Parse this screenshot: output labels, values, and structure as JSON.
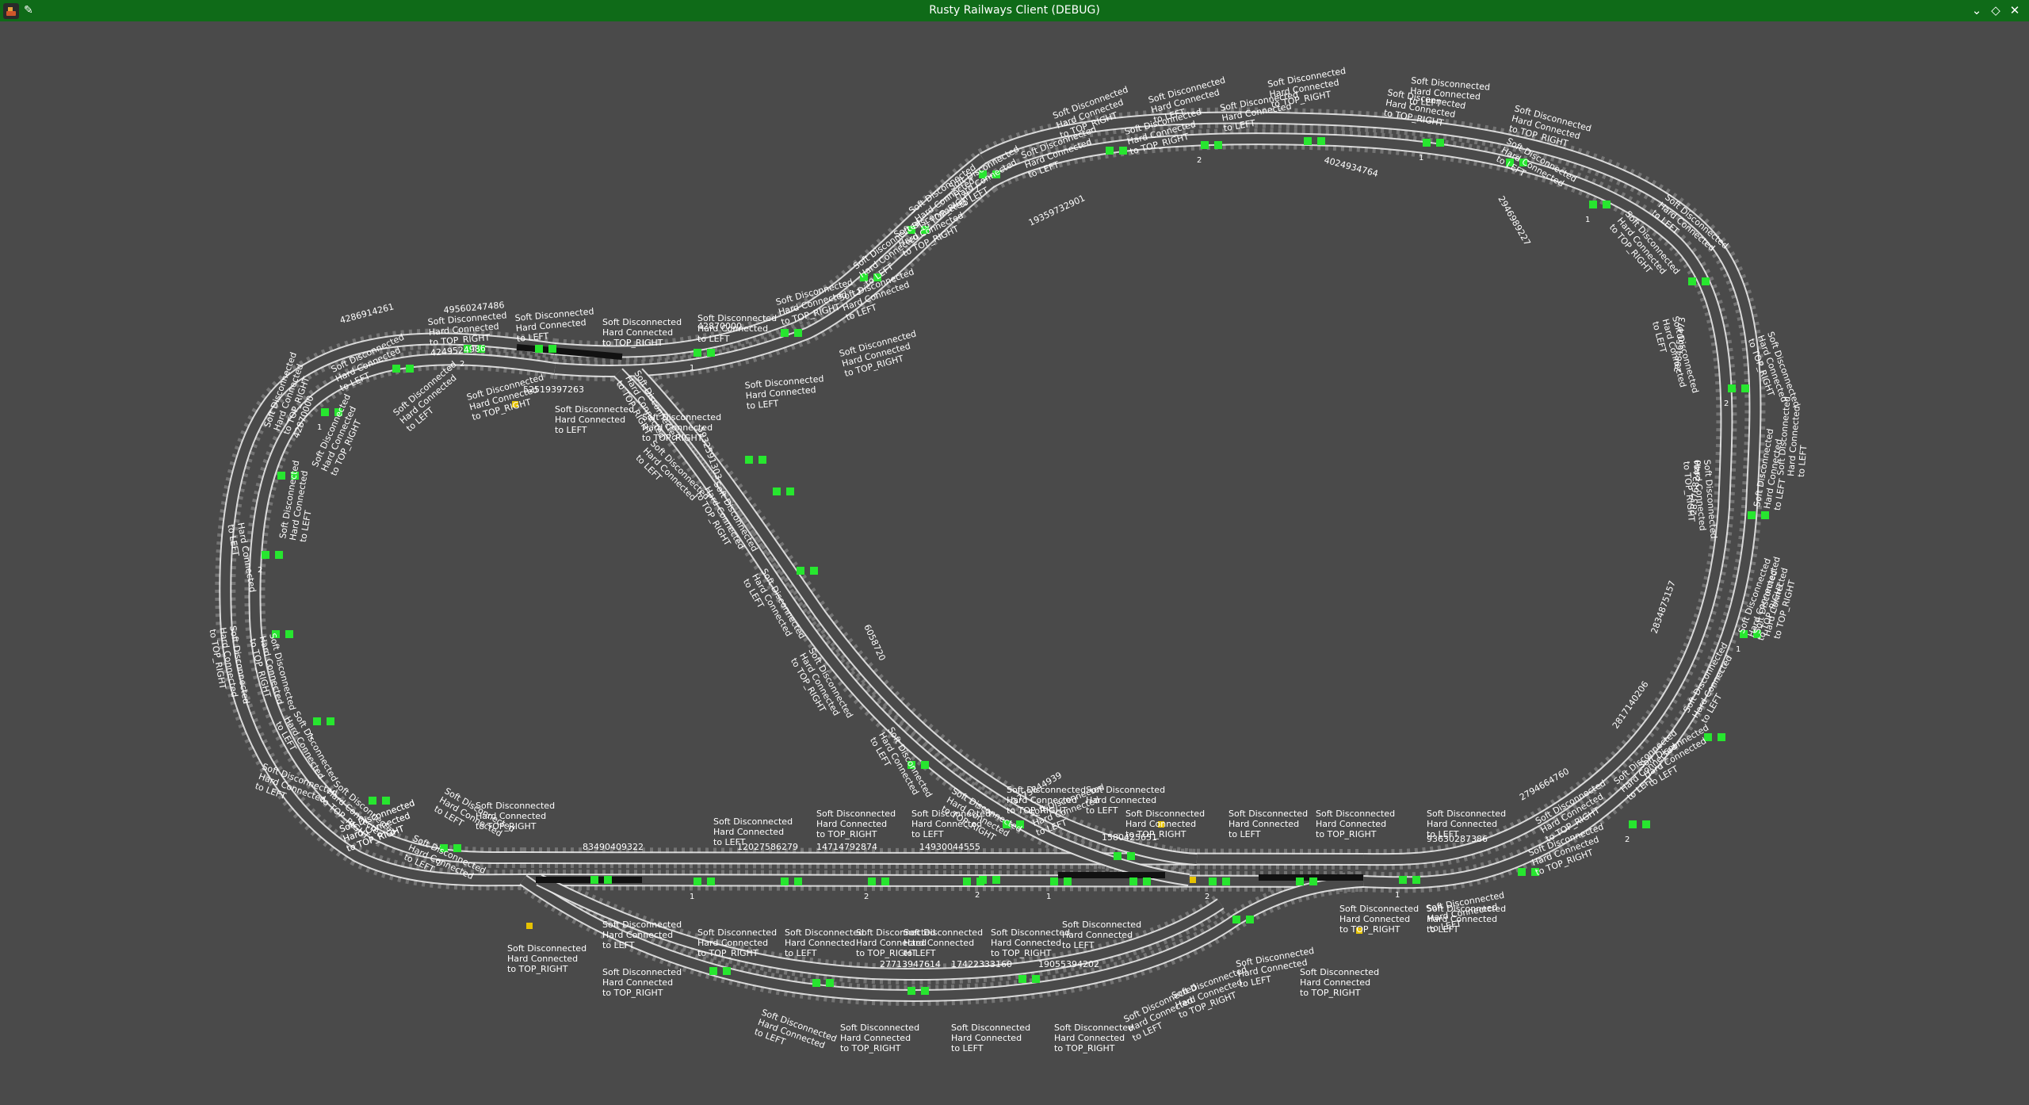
{
  "window": {
    "title": "Rusty Railways Client (DEBUG)",
    "icons": {
      "app": "app-icon",
      "pin": "pin-icon",
      "minimize": "chevron-down-icon",
      "maximize": "diamond-icon",
      "close": "close-icon"
    }
  },
  "colors": {
    "titlebar": "#0f6b18",
    "background": "#4a4a4a",
    "rail": "#e8e8e8",
    "tie": "#7a7a7a",
    "signal": "#27e62f",
    "train": "#111111",
    "switch_light": "#e6c200"
  },
  "labels": [
    {
      "id": "l1",
      "lines": [
        "Soft Disconnected",
        "Hard Connected",
        "to TOP_RIGHT"
      ]
    },
    {
      "id": "l2",
      "lines": [
        "Soft Disconnected",
        "Hard Connected",
        "to LEFT"
      ]
    },
    {
      "id": "l3",
      "lines": [
        "Soft Disconnected",
        "Hard Connected",
        "to TOP_RIGHT"
      ]
    },
    {
      "id": "l4",
      "lines": [
        "Hard Connected",
        "to LEFT"
      ]
    },
    {
      "id": "l5",
      "lines": [
        "Soft Disconnected",
        "Hard Connected",
        "to TOP_RIGHT",
        "42870000"
      ]
    },
    {
      "id": "l6",
      "lines": [
        "Soft Disconnected",
        "Hard Connected",
        "to LEFT"
      ]
    },
    {
      "id": "l7",
      "lines": [
        "Soft Disconnected",
        "Hard Connected",
        "to TOP_RIGHT",
        "4249524986"
      ]
    },
    {
      "id": "l8",
      "lines": [
        "Soft Disconnected",
        "Hard Connected",
        "to LEFT"
      ]
    },
    {
      "id": "l9",
      "lines": [
        "Soft Disconnected",
        "Hard Connected",
        "to TOP_RIGHT"
      ]
    },
    {
      "id": "l10",
      "lines": [
        "Soft Disconnected",
        "Hard Connected",
        "to LEFT"
      ]
    },
    {
      "id": "l11",
      "lines": [
        "Soft Disconnected",
        "Hard Connected",
        "to TOP_RIGHT"
      ]
    },
    {
      "id": "l12",
      "lines": [
        "Soft Disconnected",
        "Hard Connected",
        "to LEFT"
      ]
    },
    {
      "id": "l13",
      "lines": [
        "Soft Disconnected",
        "Hard Connected",
        "to TOP_RIGHT"
      ]
    },
    {
      "id": "l14",
      "lines": [
        "Soft Disconnected",
        "Hard Connected",
        "to LEFT"
      ]
    },
    {
      "id": "l15",
      "lines": [
        "Soft Disconnected",
        "Hard Connected",
        "to TOP_RIGHT"
      ]
    },
    {
      "id": "l16",
      "lines": [
        "Soft Disconnected",
        "Hard Connected",
        "to LEFT"
      ]
    },
    {
      "id": "l17",
      "lines": [
        "Soft Disconnected",
        "Hard Connected",
        "to TOP_RIGHT"
      ]
    },
    {
      "id": "l18",
      "lines": [
        "Soft Disconnected",
        "Hard Connected",
        "to LEFT"
      ]
    },
    {
      "id": "l19",
      "lines": [
        "Soft Disconnected",
        "Hard Connected",
        "to TOP_RIGHT"
      ]
    },
    {
      "id": "l20",
      "lines": [
        "Soft Disconnected",
        "Hard Connected",
        "to LEFT"
      ]
    },
    {
      "id": "l21",
      "lines": [
        "Soft Disconnected",
        "Hard Connected",
        "to TOP_RIGHT"
      ]
    },
    {
      "id": "l22",
      "lines": [
        "Soft Disconnected",
        "Hard Connected",
        "to LEFT"
      ]
    },
    {
      "id": "l23",
      "lines": [
        "Soft Disconnected",
        "Hard Connected",
        "to TOP_RIGHT"
      ]
    },
    {
      "id": "l24",
      "lines": [
        "Soft Disconnected",
        "Hard Connected",
        "to LEFT"
      ]
    },
    {
      "id": "l25",
      "lines": [
        "Soft Disconnected",
        "Hard Connected",
        "to LEFT"
      ]
    },
    {
      "id": "l26",
      "lines": [
        "Soft Disconnected",
        "Hard Connected",
        "to TOP_RIGHT"
      ]
    },
    {
      "id": "l27",
      "lines": [
        "Soft Disconnected",
        "Hard Connected",
        "to LEFT"
      ]
    },
    {
      "id": "l28",
      "lines": [
        "Soft Disconnected",
        "Hard Connected",
        "to TOP_RIGHT"
      ]
    },
    {
      "id": "l29",
      "lines": [
        "Soft Disconnected",
        "Hard Connected",
        "to LEFT"
      ]
    },
    {
      "id": "l30",
      "lines": [
        "Soft Disconnected",
        "Hard Connected",
        "to TOP_RIGHT"
      ]
    },
    {
      "id": "l31",
      "lines": [
        "Soft Disconnected",
        "Hard Connected",
        "to LEFT"
      ]
    },
    {
      "id": "l32",
      "lines": [
        "Soft Disconnected",
        "Hard Connected",
        "to TOP_RIGHT"
      ]
    },
    {
      "id": "l33",
      "lines": [
        "Soft Disconnected",
        "Hard Connected",
        "to LEFT"
      ]
    },
    {
      "id": "l34",
      "lines": [
        "Soft Disconnected",
        "Hard Connected",
        "to TOP_RIGHT"
      ]
    },
    {
      "id": "l35",
      "lines": [
        "Soft Disconnected",
        "Hard Connected",
        "to LEFT"
      ]
    },
    {
      "id": "l36",
      "lines": [
        "Soft Disconnected",
        "Hard Connected",
        "to TOP_RIGHT"
      ]
    },
    {
      "id": "l37",
      "lines": [
        "Soft Disconnected",
        "Hard Connected",
        "to LEFT"
      ]
    },
    {
      "id": "l38",
      "lines": [
        "Soft Disconnected",
        "Hard Connected",
        "to TOP_RIGHT"
      ]
    },
    {
      "id": "l39",
      "lines": [
        "Soft Disconnected",
        "Hard Connected",
        "to LEFT"
      ]
    },
    {
      "id": "l40",
      "lines": [
        "Soft Disconnected",
        "Hard Connected",
        "to TOP_RIGHT"
      ]
    },
    {
      "id": "l41",
      "lines": [
        "Soft Disconnected",
        "Hard Connected",
        "to LEFT"
      ]
    },
    {
      "id": "l42",
      "lines": [
        "Soft Disconnected",
        "Hard Connected",
        "to TOP_RIGHT"
      ]
    },
    {
      "id": "l43",
      "lines": [
        "Soft Disconnected",
        "Hard Connected",
        "to LEFT"
      ]
    },
    {
      "id": "l44",
      "lines": [
        "Soft Disconnected",
        "Hard Connected",
        "to TOP_RIGHT"
      ]
    },
    {
      "id": "l45",
      "lines": [
        "Soft Disconnected",
        "Hard Connected",
        "to LEFT"
      ]
    },
    {
      "id": "l46",
      "lines": [
        "Soft Disconnected",
        "Hard Connected",
        "to TOP_RIGHT"
      ]
    },
    {
      "id": "l47",
      "lines": [
        "Soft Disconnected",
        "Hard Connected",
        "to LEFT"
      ]
    },
    {
      "id": "l48",
      "lines": [
        "Soft Disconnected",
        "Hard Connected",
        "to TOP_RIGHT"
      ]
    },
    {
      "id": "l49",
      "lines": [
        "Soft Disconnected",
        "Hard Connected",
        "to LEFT"
      ]
    },
    {
      "id": "l50",
      "lines": [
        "Soft Disconnected",
        "Hard Connected",
        "to TOP_RIGHT"
      ]
    },
    {
      "id": "l51",
      "lines": [
        "Soft Disconnected",
        "Hard Connected",
        "to LEFT"
      ]
    },
    {
      "id": "l52",
      "lines": [
        "Soft Disconnected",
        "Hard Connected",
        "to TOP_RIGHT"
      ]
    },
    {
      "id": "l53",
      "lines": [
        "Soft Disconnected",
        "Hard Connected",
        "to LEFT"
      ]
    },
    {
      "id": "l54",
      "lines": [
        "Soft Disconnected",
        "Hard Connected",
        "to TOP_RIGHT"
      ]
    },
    {
      "id": "l55",
      "lines": [
        "Soft Disconnected",
        "Hard Connected",
        "to LEFT"
      ]
    },
    {
      "id": "l56",
      "lines": [
        "Soft Disconnected",
        "Hard Connected",
        "to TOP_RIGHT"
      ]
    },
    {
      "id": "l57",
      "lines": [
        "Soft Disconnected",
        "Hard Connected",
        "to LEFT"
      ]
    },
    {
      "id": "l58",
      "lines": [
        "Soft Disconnected",
        "Hard Connected",
        "to TOP_RIGHT"
      ]
    },
    {
      "id": "l59",
      "lines": [
        "Soft Disconnected",
        "Hard Connected",
        "to LEFT"
      ]
    },
    {
      "id": "l60",
      "lines": [
        "Soft Disconnected",
        "Hard Connected",
        "to TOP_RIGHT"
      ]
    },
    {
      "id": "l61",
      "lines": [
        "Soft Disconnected",
        "Hard Connected",
        "to LEFT"
      ]
    },
    {
      "id": "l62",
      "lines": [
        "Soft Disconnected",
        "Hard Connected",
        "to TOP_RIGHT"
      ]
    },
    {
      "id": "l63",
      "lines": [
        "Soft Disconnected",
        "Hard Connected",
        "to LEFT"
      ]
    },
    {
      "id": "l64",
      "lines": [
        "Soft Disconnected",
        "Hard Connected",
        "to TOP_RIGHT"
      ]
    },
    {
      "id": "l65",
      "lines": [
        "Soft Disconnected",
        "Hard Connected",
        "to LEFT"
      ]
    },
    {
      "id": "l66",
      "lines": [
        "Soft Disconnected",
        "Hard Connected",
        "to TOP_RIGHT"
      ]
    },
    {
      "id": "l67",
      "lines": [
        "Soft Disconnected",
        "Hard Connected",
        "to LEFT"
      ]
    },
    {
      "id": "l68",
      "lines": [
        "Soft Disconnected",
        "Hard Connected",
        "to TOP_RIGHT"
      ]
    },
    {
      "id": "l69",
      "lines": [
        "Soft Disconnected",
        "Hard Connected",
        "to LEFT"
      ]
    },
    {
      "id": "l70",
      "lines": [
        "Soft Disconnected",
        "Hard Connected",
        "to TOP_RIGHT"
      ]
    },
    {
      "id": "l71",
      "lines": [
        "Soft Disconnected",
        "Hard Connected",
        "to LEFT"
      ]
    },
    {
      "id": "l72",
      "lines": [
        "Soft Disconnected",
        "Hard Connected",
        "to TOP_RIGHT"
      ]
    },
    {
      "id": "l73",
      "lines": [
        "Soft Disconnected",
        "Hard Connected",
        "to LEFT"
      ]
    },
    {
      "id": "l74",
      "lines": [
        "Soft Disconnected",
        "Hard Connected",
        "to TOP_RIGHT"
      ]
    },
    {
      "id": "l75",
      "lines": [
        "Soft Disconnected",
        "Hard Connected",
        "to LEFT"
      ]
    },
    {
      "id": "l76",
      "lines": [
        "Soft Disconnected",
        "Hard Connected",
        "to TOP_RIGHT"
      ]
    },
    {
      "id": "l77",
      "lines": [
        "Soft Disconnected",
        "Hard Connected",
        "to LEFT"
      ]
    },
    {
      "id": "l78",
      "lines": [
        "Soft Disconnected",
        "Hard Connected",
        "to TOP_RIGHT"
      ]
    },
    {
      "id": "l79",
      "lines": [
        "Soft Disconnected",
        "Hard Connected",
        "to LEFT"
      ]
    },
    {
      "id": "l80",
      "lines": [
        "Soft Disconnected",
        "Hard Connected",
        "to TOP_RIGHT"
      ]
    },
    {
      "id": "l81",
      "lines": [
        "Soft Disconnected",
        "Hard Connected",
        "to LEFT"
      ]
    },
    {
      "id": "l82",
      "lines": [
        "Soft Disconnected",
        "Hard Connected",
        "to TOP_RIGHT"
      ]
    },
    {
      "id": "l83",
      "lines": [
        "Soft Disconnected",
        "Hard Connected",
        "to LEFT"
      ]
    },
    {
      "id": "l84",
      "lines": [
        "Soft Disconnected",
        "Hard Connected",
        "to TOP_RIGHT"
      ]
    },
    {
      "id": "l85",
      "lines": [
        "Soft Disconnected",
        "Hard Connected",
        "to LEFT"
      ]
    },
    {
      "id": "l86",
      "lines": [
        "Soft Disconnected",
        "Hard Connected",
        "to TOP_RIGHT"
      ]
    },
    {
      "id": "l87",
      "lines": [
        "Soft Disconnected",
        "Hard Connected",
        "to LEFT"
      ]
    },
    {
      "id": "l88",
      "lines": [
        "Soft Disconnected",
        "Hard Connected",
        "to TOP_RIGHT"
      ]
    },
    {
      "id": "l89",
      "lines": [
        "Soft Disconnected",
        "Hard Connected",
        "to LEFT"
      ]
    },
    {
      "id": "l90",
      "lines": [
        "Soft Disconnected",
        "Hard Connected",
        "to TOP_RIGHT"
      ]
    },
    {
      "id": "l91",
      "lines": [
        "Soft Disconnected",
        "Hard Connected",
        "to LEFT"
      ]
    },
    {
      "id": "l92",
      "lines": [
        "Soft Disconnected",
        "Hard Connected",
        "to TOP_RIGHT"
      ]
    }
  ],
  "ids": {
    "a": "4286914261",
    "b": "49560247486",
    "c": "52519397263",
    "d": "42870000",
    "e": "83490409322",
    "f": "12027586279",
    "g": "14714792874",
    "h": "14930044555",
    "i": "1580425651",
    "j": "93630287386",
    "k": "27713947614",
    "l": "17422333160",
    "m": "19055394202",
    "n": "19359732901",
    "o": "4024934764",
    "p": "2946989227",
    "q": "2984650473",
    "r": "2837682440",
    "s": "2834875157",
    "t": "2817140206",
    "u": "2794664760",
    "v": "1773844939",
    "w": "5932591303",
    "x": "6058720"
  },
  "track_numbers": [
    "1",
    "2",
    "1",
    "2",
    "1",
    "2",
    "1",
    "2",
    "1",
    "2",
    "1",
    "2",
    "1",
    "2",
    "1",
    "2",
    "1",
    "2",
    "1",
    "2"
  ]
}
